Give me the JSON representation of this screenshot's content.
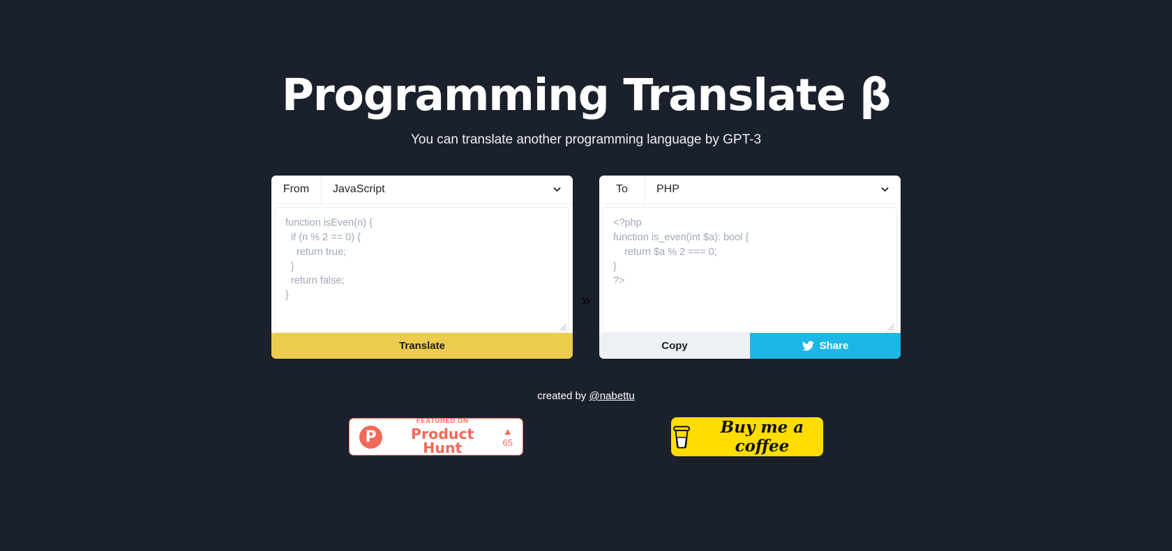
{
  "colors": {
    "background": "#1b212c",
    "translate_button": "#eccb4f",
    "copy_button": "#edf1f6",
    "share_button": "#1cb7e6",
    "product_hunt": "#f0695a",
    "buy_me_a_coffee": "#ffdd00"
  },
  "header": {
    "title": "Programming Translate β",
    "subtitle": "You can translate another programming language by GPT-3"
  },
  "translator": {
    "from": {
      "label": "From",
      "selected_language": "JavaScript",
      "code": "function isEven(n) {\n  if (n % 2 == 0) {\n    return true;\n  }\n  return false;\n}",
      "translate_label": "Translate"
    },
    "arrow": "»",
    "to": {
      "label": "To",
      "selected_language": "PHP",
      "code": "<?php\nfunction is_even(int $a): bool {\n    return $a % 2 === 0;\n}\n?>",
      "copy_label": "Copy",
      "share_label": "Share"
    }
  },
  "footer": {
    "created_prefix": "created by ",
    "author_handle": "@nabettu",
    "product_hunt": {
      "logo_letter": "P",
      "featured_text": "FEATURED ON",
      "name": "Product Hunt",
      "upvote_triangle": "▲",
      "upvote_count": "65"
    },
    "buy_me_a_coffee": {
      "label": "Buy me a coffee"
    }
  }
}
